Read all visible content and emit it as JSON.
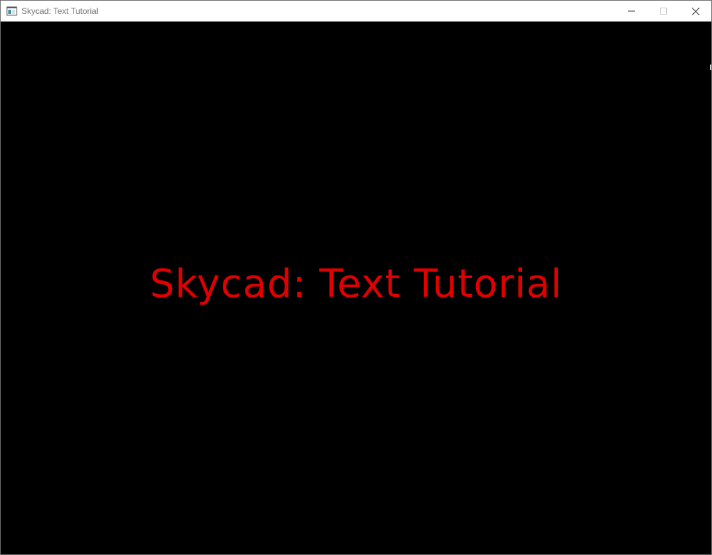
{
  "window": {
    "title": "Skycad: Text Tutorial"
  },
  "content": {
    "headline": "Skycad: Text Tutorial",
    "headline_color": "#e00000",
    "background_color": "#000000"
  },
  "controls": {
    "minimize_icon": "minimize-icon",
    "maximize_icon": "maximize-icon",
    "close_icon": "close-icon"
  }
}
